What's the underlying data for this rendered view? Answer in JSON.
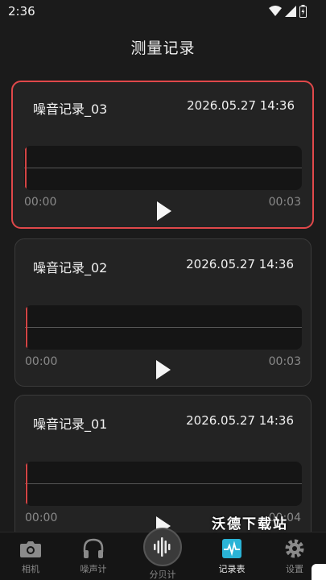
{
  "status": {
    "time": "2:36"
  },
  "header": {
    "title": "测量记录"
  },
  "records": [
    {
      "name": "噪音记录_03",
      "date": "2026.05.27 14:36",
      "start": "00:00",
      "end": "00:03"
    },
    {
      "name": "噪音记录_02",
      "date": "2026.05.27 14:36",
      "start": "00:00",
      "end": "00:03"
    },
    {
      "name": "噪音记录_01",
      "date": "2026.05.27 14:36",
      "start": "00:00",
      "end": "00:04"
    }
  ],
  "nav": {
    "camera": "相机",
    "noise_meter": "噪声计",
    "decibel_meter": "分贝计",
    "records": "记录表",
    "settings": "设置"
  },
  "watermark": "沃德下载站",
  "colors": {
    "accent": "#e0484a",
    "active_tab": "#2ab3d6",
    "background": "#1b1b1b"
  }
}
